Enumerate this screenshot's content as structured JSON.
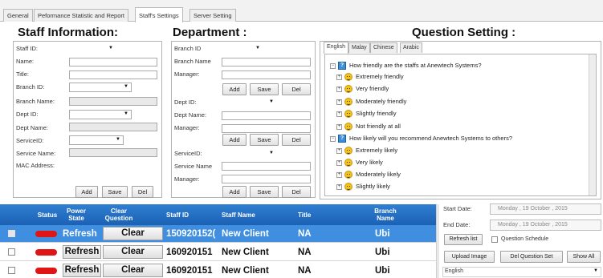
{
  "top_tabs": [
    "General",
    "Peformance Statistic and Report",
    "Staff's Settings",
    "Server Setting"
  ],
  "staff": {
    "title": "Staff Information:",
    "fields": {
      "staff_id": "Staff ID:",
      "name": "Name:",
      "title": "Title:",
      "branch_id": "Branch ID:",
      "branch_name": "Branch Name:",
      "dept_id": "Dept ID:",
      "dept_name": "Dept Name:",
      "service_id": "ServiceID:",
      "service_name": "Service Name:",
      "mac": "MAC Address:"
    },
    "buttons": {
      "add": "Add",
      "save": "Save",
      "del": "Del"
    }
  },
  "department": {
    "title": "Department :",
    "fields": {
      "branch_id": "Branch ID",
      "branch_name": "Branch Name",
      "manager": "Manager:",
      "dept_id": "Dept ID:",
      "dept_name": "Dept Name:",
      "manager2": "Manager:",
      "service_id": "ServiceID:",
      "service_name": "Service Name",
      "manager3": "Manager:"
    },
    "buttons": {
      "add": "Add",
      "save": "Save",
      "del": "Del"
    }
  },
  "question": {
    "title": "Question Setting :",
    "lang_tabs": [
      "English",
      "Malay",
      "Chinese",
      "Arabic"
    ],
    "q1": "How friendly are the staffs at Anewtech Systems?",
    "a1": [
      "Extremely friendly",
      "Very friendly",
      "Moderately friendly",
      "Slightly friendly",
      "Not friendly at all"
    ],
    "q2": "How likely will you recommend Anewtech Systems to others?",
    "a2": [
      "Extremely likely",
      "Very likely",
      "Moderately likely",
      "Slightly likely"
    ]
  },
  "grid": {
    "headers": [
      "Status",
      "Power State",
      "Clear Question",
      "Staff ID",
      "Staff Name",
      "Title",
      "Branch Name"
    ],
    "rows": [
      {
        "power": "Refresh",
        "clear": "Clear",
        "staff_id": "150920152(",
        "name": "New Client",
        "title": "NA",
        "branch": "Ubi"
      },
      {
        "power": "Refresh",
        "clear": "Clear",
        "staff_id": "160920151",
        "name": "New Client",
        "title": "NA",
        "branch": "Ubi"
      },
      {
        "power": "Refresh",
        "clear": "Clear",
        "staff_id": "160920151",
        "name": "New Client",
        "title": "NA",
        "branch": "Ubi"
      }
    ]
  },
  "controls": {
    "start_label": "Start Date:",
    "start_value": "Monday   , 19   October  , 2015",
    "end_label": "End Date:",
    "end_value": "Monday   , 19   October  , 2015",
    "refresh_list": "Refresh list",
    "question_schedule": "Question Schedule",
    "upload_image": "Upload Image",
    "del_question_set": "Del Question Set",
    "show_all": "Show All",
    "language": "English"
  },
  "colors": {
    "grid_header": "#1b61b5",
    "selected_row": "#3f8ee0",
    "status_pill": "#e01616"
  }
}
